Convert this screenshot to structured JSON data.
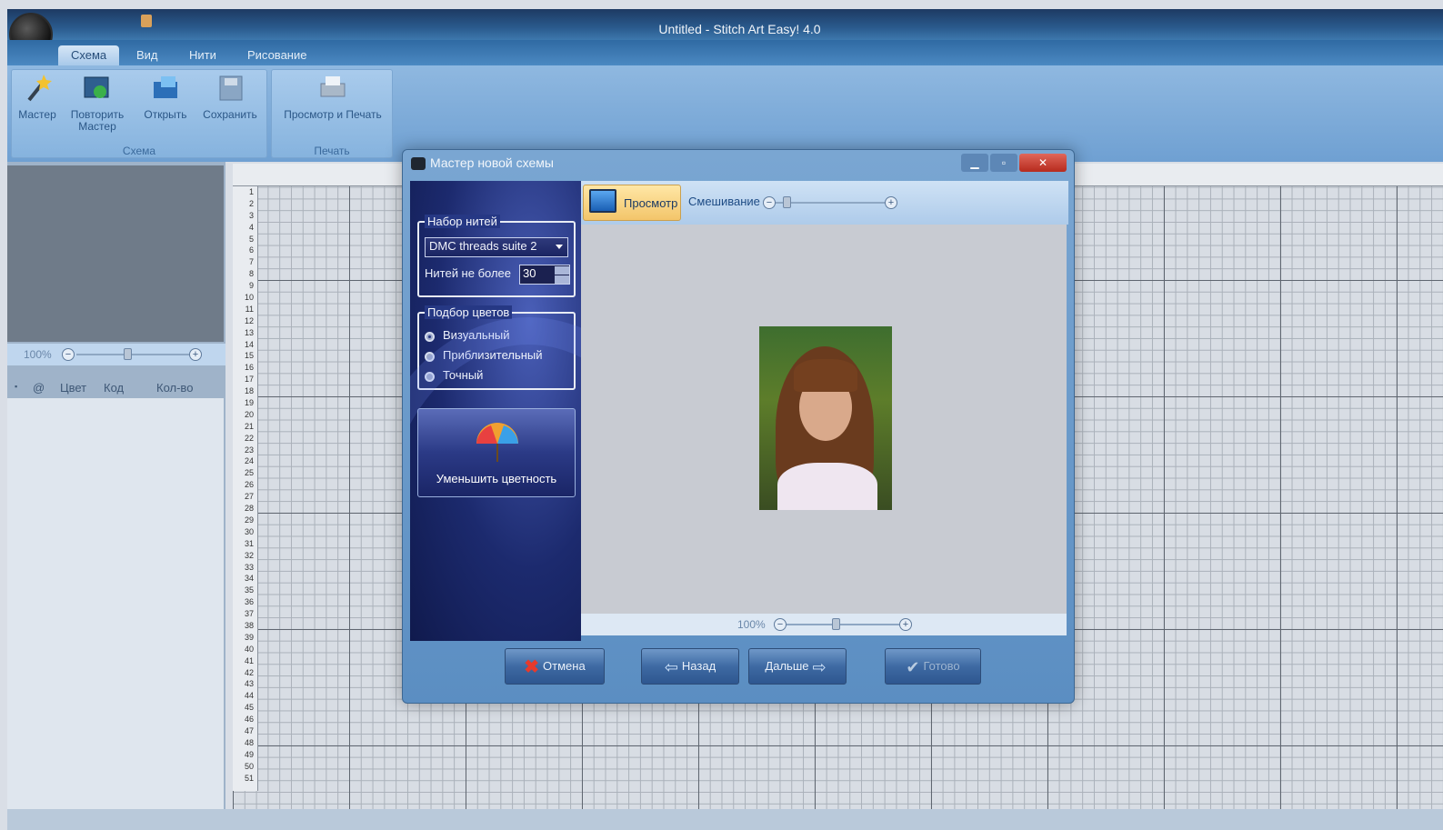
{
  "app": {
    "title": "Untitled - Stitch Art Easy! 4.0"
  },
  "ribbon": {
    "tabs": [
      "Схема",
      "Вид",
      "Нити",
      "Рисование"
    ],
    "groups": [
      {
        "label": "Схема",
        "buttons": [
          "Мастер",
          "Повторить Мастер",
          "Открыть",
          "Сохранить"
        ]
      },
      {
        "label": "Печать",
        "buttons": [
          "Просмотр и Печать"
        ]
      }
    ]
  },
  "left_panel": {
    "zoom": "100%",
    "columns": [
      "@",
      "Цвет",
      "Код",
      "Кол-во"
    ]
  },
  "ruler": {
    "rows": [
      "1",
      "2",
      "3",
      "4",
      "5",
      "6",
      "7",
      "8",
      "9",
      "10",
      "11",
      "12",
      "13",
      "14",
      "15",
      "16",
      "17",
      "18",
      "19",
      "20",
      "21",
      "22",
      "23",
      "24",
      "25",
      "26",
      "27",
      "28",
      "29",
      "30",
      "31",
      "32",
      "33",
      "34",
      "35",
      "36",
      "37",
      "38",
      "39",
      "40",
      "41",
      "42",
      "43",
      "44",
      "45",
      "46",
      "47",
      "48",
      "49",
      "50",
      "51"
    ]
  },
  "dialog": {
    "title": "Мастер новой схемы",
    "thread_set": {
      "legend": "Набор нитей",
      "selected": "DMC threads suite 2",
      "max_label": "Нитей не более",
      "max_value": "30"
    },
    "color_match": {
      "legend": "Подбор цветов",
      "options": [
        "Визуальный",
        "Приблизительный",
        "Точный"
      ],
      "selected_index": 0
    },
    "reduce_button": "Уменьшить цветность",
    "preview_button": "Просмотр",
    "mix_label": "Смешивание",
    "mix_level": 0.1,
    "preview_zoom": "100%",
    "buttons": {
      "cancel": "Отмена",
      "back": "Назад",
      "next": "Дальше",
      "done": "Готово"
    }
  },
  "colors": {
    "ribbon": "#6fa0d2",
    "dialog_side": "#1c2a6e",
    "preview_active": "#f3c56a"
  }
}
